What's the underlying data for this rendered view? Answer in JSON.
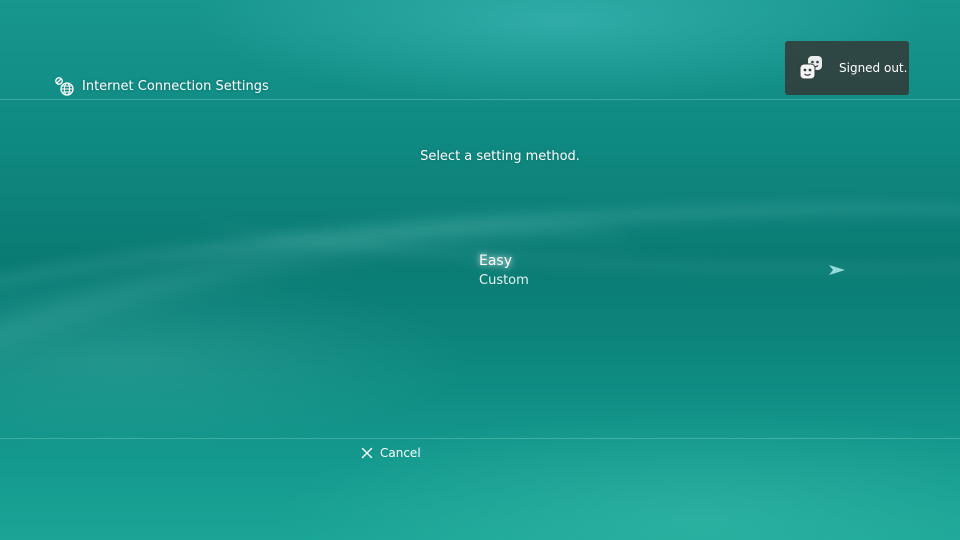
{
  "header": {
    "icon": "network-settings-icon",
    "title": "Internet Connection Settings"
  },
  "notification": {
    "icon": "friends-faces-icon",
    "text": "Signed out."
  },
  "prompt": "Select a setting method.",
  "menu": {
    "items": [
      {
        "label": "Easy",
        "selected": true
      },
      {
        "label": "Custom",
        "selected": false
      }
    ]
  },
  "navigation": {
    "icon": "right-arrow-icon"
  },
  "footer": {
    "cancel_icon": "cross-button-icon",
    "cancel_label": "Cancel"
  },
  "colors": {
    "background": "#0f8a82",
    "text": "#ffffff",
    "toast_background": "#323c3a"
  }
}
